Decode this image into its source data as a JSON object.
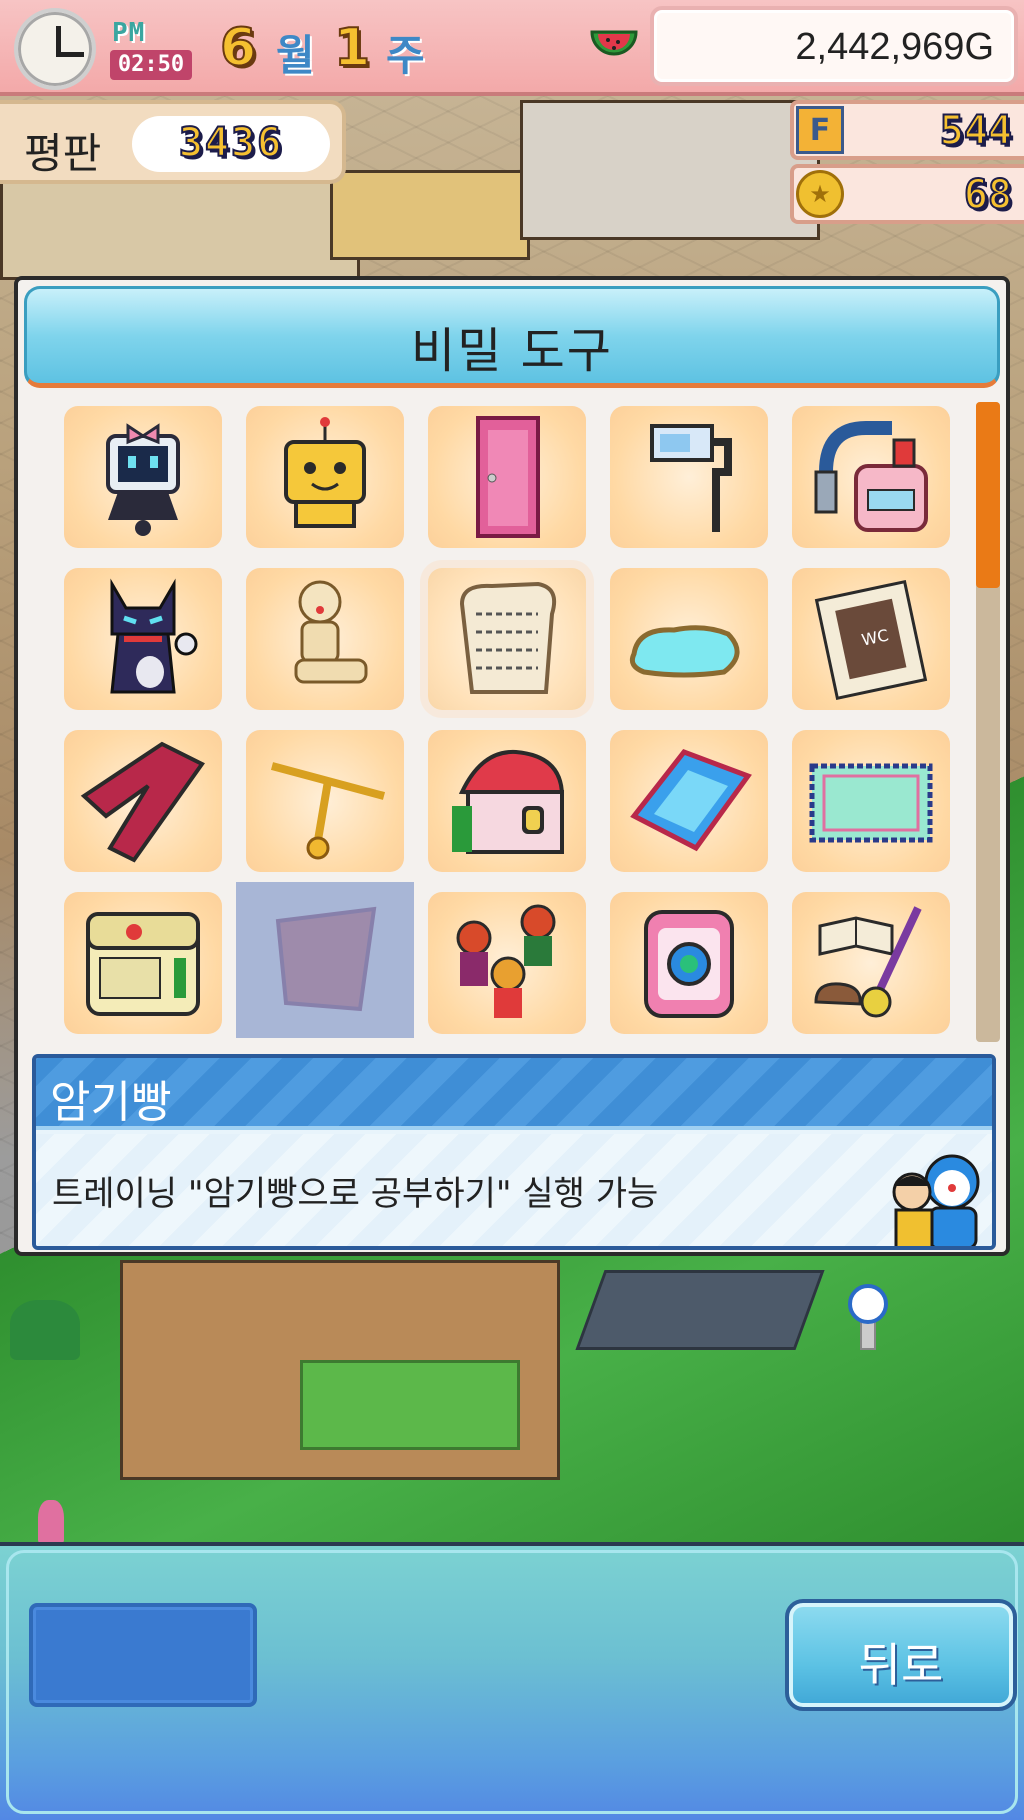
{
  "hud": {
    "ampm": "PM",
    "time": "02:50",
    "month_num": "6",
    "month_word": "월",
    "week_num": "1",
    "week_word": "주",
    "money": "2,442,969G",
    "reputation_label": "평판",
    "reputation_value": "3436",
    "f_points": "544",
    "coins": "68",
    "icons": [
      "clock-icon",
      "watermelon-icon",
      "f-point-icon",
      "coin-icon"
    ]
  },
  "modal": {
    "title": "비밀 도구",
    "items": [
      {
        "icon": "robot-girl-icon",
        "state": "normal"
      },
      {
        "icon": "yellow-robot-icon",
        "state": "normal"
      },
      {
        "icon": "pink-door-icon",
        "state": "normal"
      },
      {
        "icon": "roller-icon",
        "state": "normal"
      },
      {
        "icon": "machine-icon",
        "state": "normal"
      },
      {
        "icon": "black-cat-icon",
        "state": "normal"
      },
      {
        "icon": "wooden-doll-icon",
        "state": "normal"
      },
      {
        "icon": "memory-bread-icon",
        "state": "selected"
      },
      {
        "icon": "pool-icon",
        "state": "normal"
      },
      {
        "icon": "wc-card-icon",
        "state": "normal"
      },
      {
        "icon": "red-pants-icon",
        "state": "normal"
      },
      {
        "icon": "copter-icon",
        "state": "normal"
      },
      {
        "icon": "mini-house-icon",
        "state": "normal"
      },
      {
        "icon": "blue-mat-icon",
        "state": "normal"
      },
      {
        "icon": "rug-icon",
        "state": "normal"
      },
      {
        "icon": "camera-icon",
        "state": "normal"
      },
      {
        "icon": "cloth-icon",
        "state": "locked"
      },
      {
        "icon": "band-icon",
        "state": "normal"
      },
      {
        "icon": "pink-device-icon",
        "state": "normal"
      },
      {
        "icon": "book-guitar-icon",
        "state": "normal"
      }
    ],
    "selected_name": "암기빵",
    "selected_description": "트레이닝 \"암기빵으로 공부하기\" 실행 가능"
  },
  "bottom": {
    "back_label": "뒤로"
  },
  "colors": {
    "accent_orange": "#ea7a16",
    "header_blue": "#5ec2e2",
    "desc_blue": "#3f8ed6"
  }
}
